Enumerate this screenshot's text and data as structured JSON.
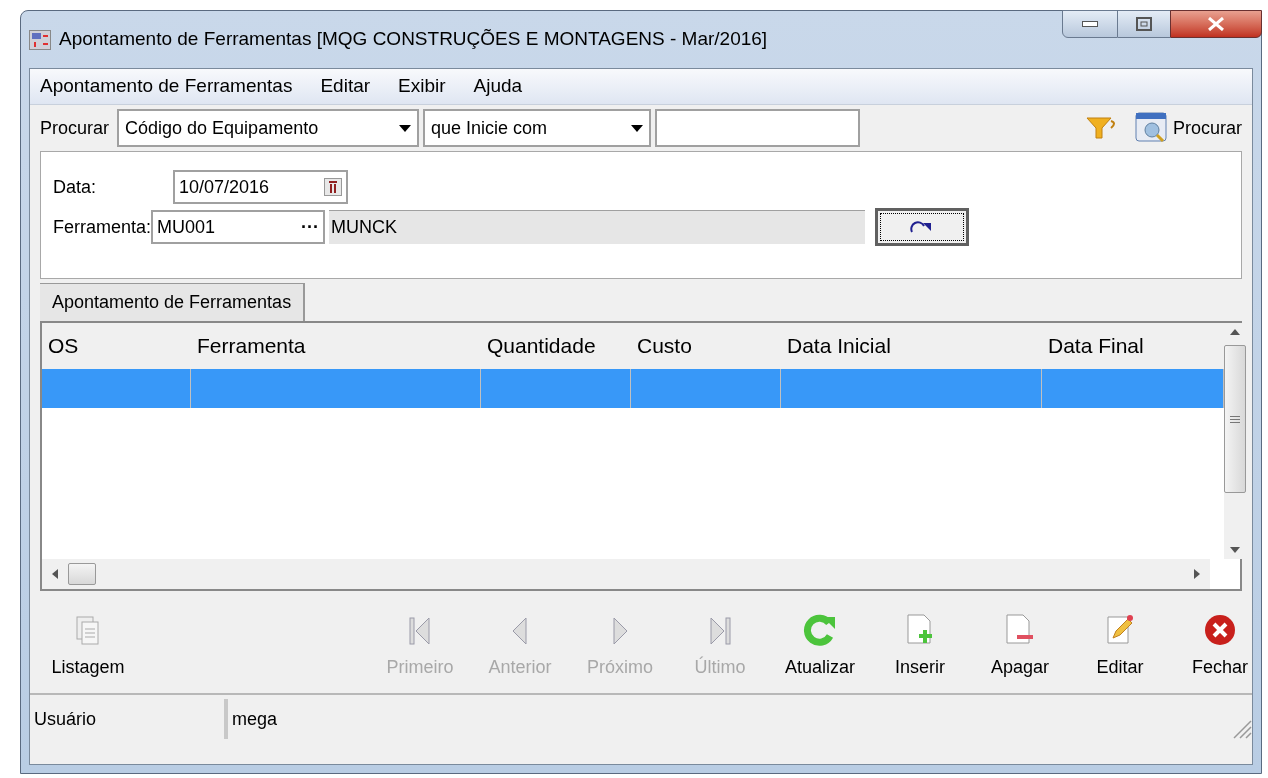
{
  "window": {
    "title": "Apontamento de Ferramentas [MQG CONSTRUÇÕES E MONTAGENS - Mar/2016]"
  },
  "menu": [
    "Apontamento de Ferramentas",
    "Editar",
    "Exibir",
    "Ajuda"
  ],
  "search": {
    "label": "Procurar",
    "field": "Código do Equipamento",
    "operator": "que Inicie com",
    "button": "Procurar"
  },
  "form": {
    "date_label": "Data:",
    "date": "10/07/2016",
    "tool_label": "Ferramenta:",
    "tool_code": "MU001",
    "tool_browse": "···",
    "tool_name": "MUNCK"
  },
  "tabs": [
    {
      "label": "Apontamento de Ferramentas",
      "selected": true
    }
  ],
  "table": {
    "columns": [
      "OS",
      "Ferramenta",
      "Quantidade",
      "Custo",
      "Data Inicial",
      "Data Final"
    ],
    "rows": [
      {
        "selected": true
      }
    ]
  },
  "toolbar": [
    {
      "kind": "list",
      "label": "Listagem",
      "disabled": false
    },
    {
      "kind": "first",
      "label": "Primeiro",
      "disabled": true
    },
    {
      "kind": "prev",
      "label": "Anterior",
      "disabled": true
    },
    {
      "kind": "next",
      "label": "Próximo",
      "disabled": true
    },
    {
      "kind": "last",
      "label": "Último",
      "disabled": true
    },
    {
      "kind": "refresh",
      "label": "Atualizar",
      "disabled": false
    },
    {
      "kind": "insert",
      "label": "Inserir",
      "disabled": false
    },
    {
      "kind": "delete",
      "label": "Apagar",
      "disabled": false
    },
    {
      "kind": "edit",
      "label": "Editar",
      "disabled": false
    },
    {
      "kind": "close",
      "label": "Fechar",
      "disabled": false
    }
  ],
  "status_bar": [
    "Usuário",
    "mega"
  ]
}
